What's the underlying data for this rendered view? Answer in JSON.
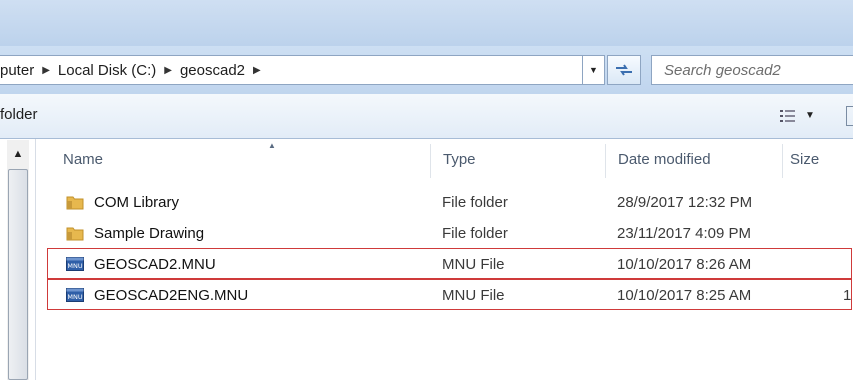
{
  "address": {
    "segments": [
      "puter",
      "Local Disk (C:)",
      "geoscad2"
    ],
    "search_placeholder": "Search geoscad2"
  },
  "toolbar": {
    "new_folder_label": "folder"
  },
  "columns": {
    "name": "Name",
    "type": "Type",
    "date": "Date modified",
    "size": "Size"
  },
  "files": [
    {
      "name": "COM Library",
      "type": "File folder",
      "date": "28/9/2017 12:32 PM",
      "size": "",
      "icon": "folder-icon"
    },
    {
      "name": "Sample Drawing",
      "type": "File folder",
      "date": "23/11/2017 4:09 PM",
      "size": "",
      "icon": "folder-icon"
    },
    {
      "name": "GEOSCAD2.MNU",
      "type": "MNU File",
      "date": "10/10/2017 8:26 AM",
      "size": "",
      "icon": "mnu-file-icon",
      "highlighted": true
    },
    {
      "name": "GEOSCAD2ENG.MNU",
      "type": "MNU File",
      "date": "10/10/2017 8:25 AM",
      "size": "1",
      "icon": "mnu-file-icon",
      "highlighted": true
    }
  ],
  "icon_label": "MNU",
  "colors": {
    "highlight_border": "#cf3a3a",
    "folder": "#e7b84e"
  }
}
